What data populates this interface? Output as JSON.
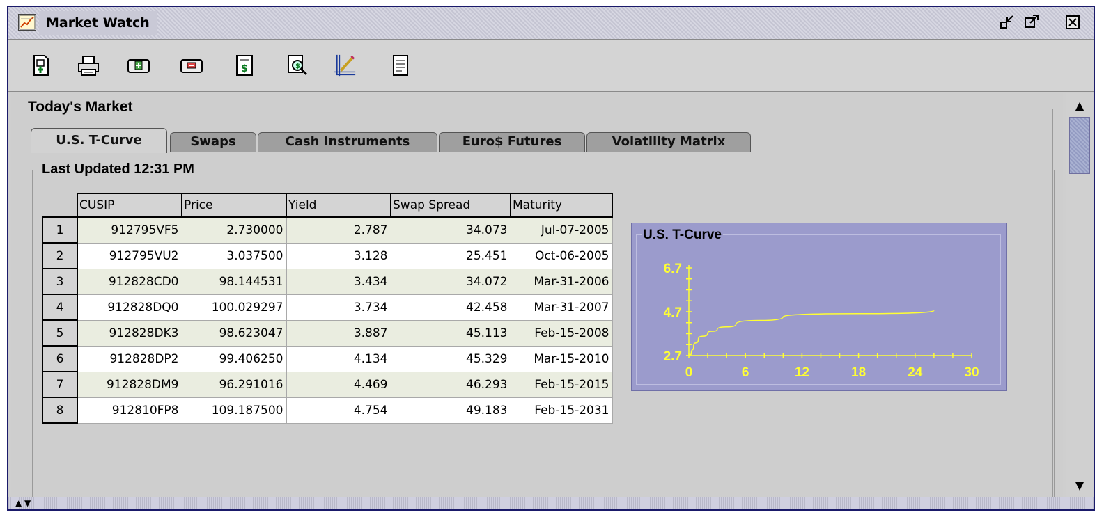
{
  "window": {
    "title": "Market Watch",
    "title_icon": "chart-icon",
    "controls": [
      "restore-icon",
      "maximize-icon",
      "close-icon"
    ]
  },
  "toolbar": {
    "tools": [
      {
        "name": "new-instrument-icon"
      },
      {
        "name": "print-icon"
      },
      {
        "name": "add-icon"
      },
      {
        "name": "remove-icon"
      },
      {
        "name": "pricing-icon"
      },
      {
        "name": "search-price-icon"
      },
      {
        "name": "edit-chart-icon"
      },
      {
        "name": "report-icon"
      }
    ]
  },
  "market": {
    "group_title": "Today's Market",
    "tabs": [
      "U.S. T-Curve",
      "Swaps",
      "Cash Instruments",
      "Euro$ Futures",
      "Volatility Matrix"
    ],
    "active_tab": 0,
    "last_updated": "Last Updated 12:31 PM"
  },
  "table": {
    "columns": [
      "CUSIP",
      "Price",
      "Yield",
      "Swap Spread",
      "Maturity"
    ],
    "rows": [
      {
        "n": "1",
        "cusip": "912795VF5",
        "price": "2.730000",
        "yield": "2.787",
        "spread": "34.073",
        "maturity": "Jul-07-2005"
      },
      {
        "n": "2",
        "cusip": "912795VU2",
        "price": "3.037500",
        "yield": "3.128",
        "spread": "25.451",
        "maturity": "Oct-06-2005"
      },
      {
        "n": "3",
        "cusip": "912828CD0",
        "price": "98.144531",
        "yield": "3.434",
        "spread": "34.072",
        "maturity": "Mar-31-2006"
      },
      {
        "n": "4",
        "cusip": "912828DQ0",
        "price": "100.029297",
        "yield": "3.734",
        "spread": "42.458",
        "maturity": "Mar-31-2007"
      },
      {
        "n": "5",
        "cusip": "912828DK3",
        "price": "98.623047",
        "yield": "3.887",
        "spread": "45.113",
        "maturity": "Feb-15-2008"
      },
      {
        "n": "6",
        "cusip": "912828DP2",
        "price": "99.406250",
        "yield": "4.134",
        "spread": "45.329",
        "maturity": "Mar-15-2010"
      },
      {
        "n": "7",
        "cusip": "912828DM9",
        "price": "96.291016",
        "yield": "4.469",
        "spread": "46.293",
        "maturity": "Feb-15-2015"
      },
      {
        "n": "8",
        "cusip": "912810FP8",
        "price": "109.187500",
        "yield": "4.754",
        "spread": "49.183",
        "maturity": "Feb-15-2031"
      }
    ]
  },
  "chart_data": {
    "type": "line",
    "title": "U.S. T-Curve",
    "x_ticks": [
      "0",
      "6",
      "12",
      "18",
      "24",
      "30"
    ],
    "y_ticks": [
      "2.7",
      "4.7",
      "6.7"
    ],
    "xlim": [
      0,
      30
    ],
    "ylim": [
      2.7,
      6.7
    ],
    "series": [
      {
        "x": [
          0.25,
          0.5,
          1,
          2,
          3,
          5,
          10,
          26
        ],
        "y": [
          2.787,
          3.128,
          3.434,
          3.734,
          3.887,
          4.134,
          4.469,
          4.754
        ]
      }
    ],
    "line_color": "#ffff33",
    "background_color": "#9b9bcc"
  },
  "colors": {
    "title_bar": "#c9c9d6",
    "row_tint": "#eaede0",
    "panel": "#cecece"
  }
}
